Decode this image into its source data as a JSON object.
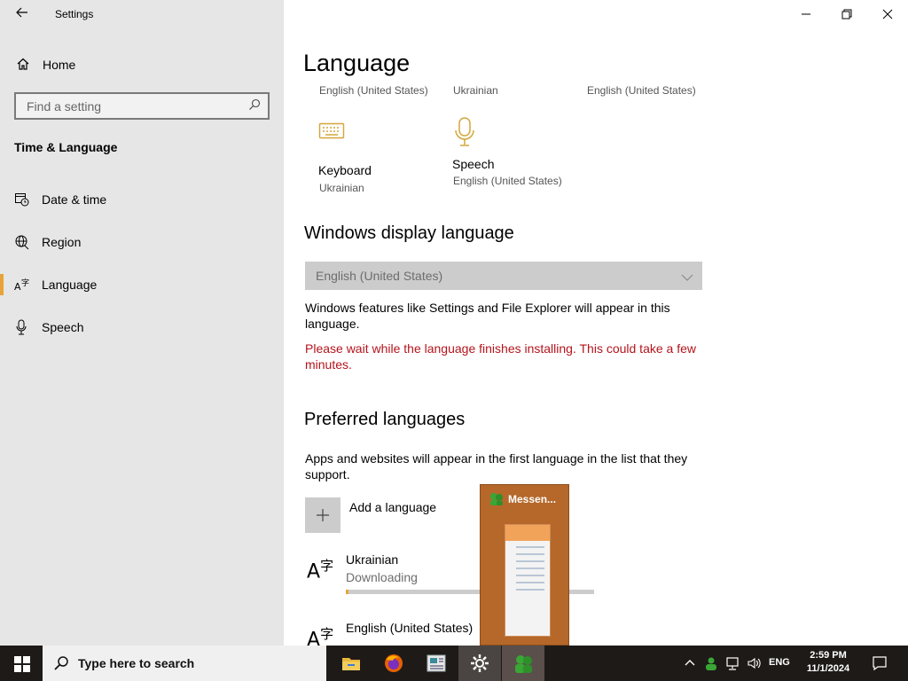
{
  "window": {
    "title": "Settings"
  },
  "sidebar": {
    "home_label": "Home",
    "search_placeholder": "Find a setting",
    "section_title": "Time & Language",
    "items": [
      {
        "label": "Date & time",
        "icon": "calendar-clock-icon",
        "selected": false
      },
      {
        "label": "Region",
        "icon": "globe-icon",
        "selected": false
      },
      {
        "label": "Language",
        "icon": "language-icon",
        "selected": true
      },
      {
        "label": "Speech",
        "icon": "microphone-icon",
        "selected": false
      }
    ]
  },
  "main": {
    "page_title": "Language",
    "top_row": [
      "English (United States)",
      "Ukrainian",
      "English (United States)"
    ],
    "tiles": [
      {
        "name": "Keyboard",
        "sub": "Ukrainian",
        "icon": "keyboard-icon"
      },
      {
        "name": "Speech",
        "sub": "English (United States)",
        "icon": "microphone-icon"
      }
    ],
    "display_language": {
      "heading": "Windows display language",
      "dropdown_value": "English (United States)",
      "description": "Windows features like Settings and File Explorer will appear in this language.",
      "warning": "Please wait while the language finishes installing. This could take a few minutes."
    },
    "preferred": {
      "heading": "Preferred languages",
      "description": "Apps and websites will appear in the first language in the list that they support.",
      "add_label": "Add a language",
      "languages": [
        {
          "name": "Ukrainian",
          "status": "Downloading",
          "progress": 0.01
        },
        {
          "name": "English (United States)",
          "status": ""
        }
      ]
    }
  },
  "thumbnail": {
    "title": "Messen..."
  },
  "taskbar": {
    "search_text": "Type here to search",
    "apps": [
      "file-explorer-icon",
      "firefox-icon",
      "news-app-icon",
      "settings-icon",
      "messenger-icon"
    ],
    "language": "ENG",
    "time": "2:59 PM",
    "date": "11/1/2024"
  },
  "colors": {
    "accent": "#e8a33a",
    "warning": "#b4141c",
    "sidebar_bg": "#e6e6e6",
    "taskbar_bg": "#1e1a18"
  }
}
